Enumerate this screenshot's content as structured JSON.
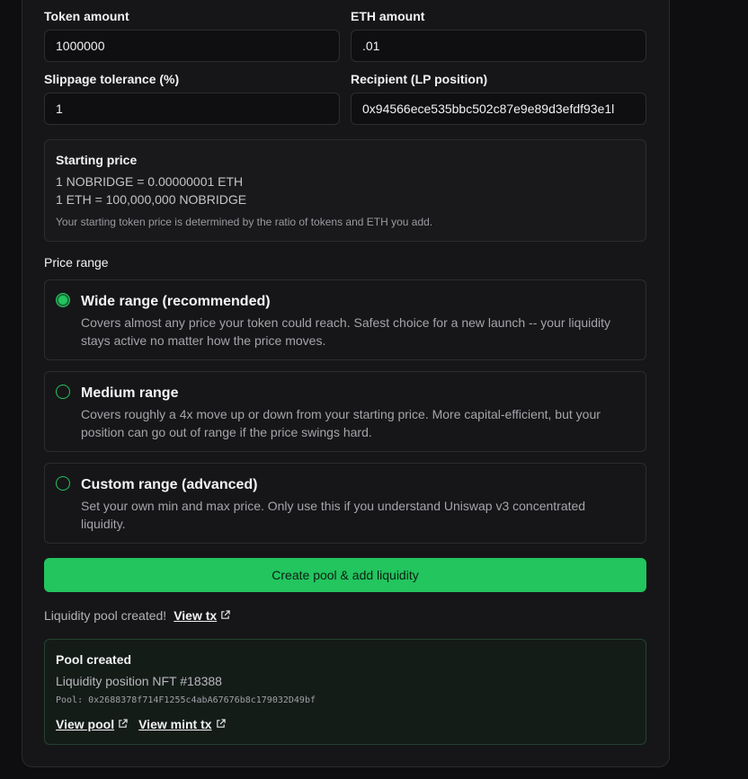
{
  "form": {
    "token_amount_label": "Token amount",
    "token_amount_value": "1000000",
    "eth_amount_label": "ETH amount",
    "eth_amount_value": ".01",
    "slippage_label": "Slippage tolerance (%)",
    "slippage_value": "1",
    "recipient_label": "Recipient (LP position)",
    "recipient_value": "0x94566ece535bbc502c87e9e89d3efdf93e1l"
  },
  "starting_price": {
    "title": "Starting price",
    "line1": "1 NOBRIDGE = 0.00000001 ETH",
    "line2": "1 ETH = 100,000,000 NOBRIDGE",
    "note": "Your starting token price is determined by the ratio of tokens and ETH you add."
  },
  "price_range": {
    "label": "Price range",
    "options": [
      {
        "title": "Wide range (recommended)",
        "description": "Covers almost any price your token could reach. Safest choice for a new launch -- your liquidity stays active no matter how the price moves.",
        "selected": true
      },
      {
        "title": "Medium range",
        "description": "Covers roughly a 4x move up or down from your starting price. More capital-efficient, but your position can go out of range if the price swings hard.",
        "selected": false
      },
      {
        "title": "Custom range (advanced)",
        "description": "Set your own min and max price. Only use this if you understand Uniswap v3 concentrated liquidity.",
        "selected": false
      }
    ]
  },
  "cta_label": "Create pool & add liquidity",
  "status": {
    "text": "Liquidity pool created!",
    "link": "View tx"
  },
  "pool": {
    "title": "Pool created",
    "nft": "Liquidity position NFT #18388",
    "address": "Pool: 0x2688378f714F1255c4abA67676b8c179032D49bf",
    "view_pool": "View pool",
    "view_mint_tx": "View mint tx"
  },
  "colors": {
    "accent": "#22c55e",
    "background": "#0e0e10",
    "card": "#161618"
  },
  "icons": {
    "external_link": "external-link-icon",
    "radio": "radio-icon"
  }
}
